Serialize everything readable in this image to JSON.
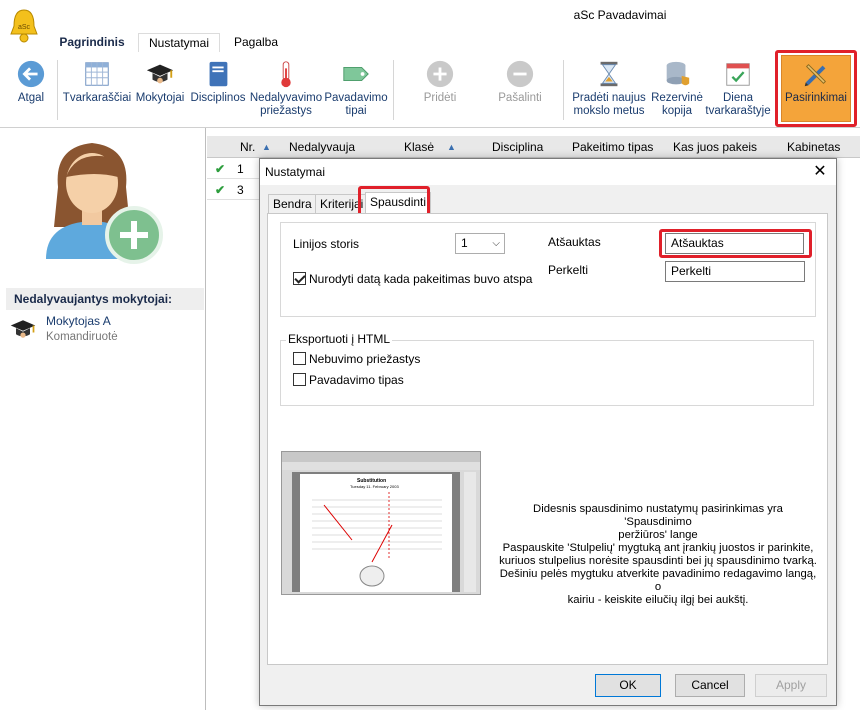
{
  "app": {
    "title": "aSc Pavadavimai",
    "logo_text": "aSc"
  },
  "menu": {
    "tabs": [
      "Pagrindinis",
      "Nustatymai",
      "Pagalba"
    ],
    "active": "Nustatymai"
  },
  "ribbon": {
    "back": "Atgal",
    "timetables": "Tvarkaraščiai",
    "teachers": "Mokytojai",
    "subjects": "Disciplinos",
    "absence_reasons": [
      "Nedalyvavimo",
      "priežastys"
    ],
    "substitution_types": [
      "Pavadavimo",
      "tipai"
    ],
    "add": "Pridėti",
    "remove": "Pašalinti",
    "new_year": [
      "Pradėti naujus",
      "mokslo metus"
    ],
    "backup": [
      "Rezervinė",
      "kopija"
    ],
    "day_timetable": [
      "Diena",
      "tvarkaraštyje"
    ],
    "custom": "Pasirinkimai"
  },
  "left_panel": {
    "absent_header": "Nedalyvaujantys mokytojai:",
    "absent_teachers": [
      {
        "name": "Mokytojas A",
        "reason": "Komandiruotė"
      }
    ]
  },
  "grid": {
    "columns": [
      "Nr.",
      "Nedalyvauja",
      "Klasė",
      "Disciplina",
      "Pakeitimo tipas",
      "Kas juos pakeis",
      "Kabinetas"
    ],
    "rows": [
      {
        "nr": "1",
        "status": "check"
      },
      {
        "nr": "3",
        "status": "check"
      }
    ]
  },
  "dialog": {
    "title": "Nustatymai",
    "tabs": [
      "Bendra",
      "Kriterijai",
      "Spausdinti"
    ],
    "active_tab": "Spausdinti",
    "line_width_label": "Linijos storis",
    "line_width_value": "1",
    "date_checkbox_label": "Nurodyti datą kada pakeitimas buvo atspa",
    "date_checkbox_checked": true,
    "cancelled_label": "Atšauktas",
    "cancelled_value": "Atšauktas",
    "moved_label": "Perkelti",
    "moved_value": "Perkelti",
    "export_group": "Eksportuoti į HTML",
    "export_absence_reasons": "Nebuvimo priežastys",
    "export_substitution_type": "Pavadavimo tipas",
    "preview": {
      "title": "Substitution",
      "date": "Tuesday 11. February 2003"
    },
    "info_lines": [
      "Didesnis spausdinimo nustatymų pasirinkimas yra 'Spausdinimo",
      "peržiūros' lange",
      "Paspauskite 'Stulpelių' mygtuką ant įrankių juostos ir parinkite,",
      "kuriuos stulpelius norėsite spausdinti bei jų spausdinimo tvarką.",
      "Dešiniu pelės mygtuku atverkite pavadinimo redagavimo langą, o",
      "kairiu - keiskite eilučių ilgį bei aukštį."
    ],
    "ok": "OK",
    "cancel": "Cancel",
    "apply": "Apply"
  },
  "colors": {
    "accent_orange": "#f4a43a",
    "highlight_red": "#e0202a",
    "link_blue": "#1a3c6e"
  }
}
